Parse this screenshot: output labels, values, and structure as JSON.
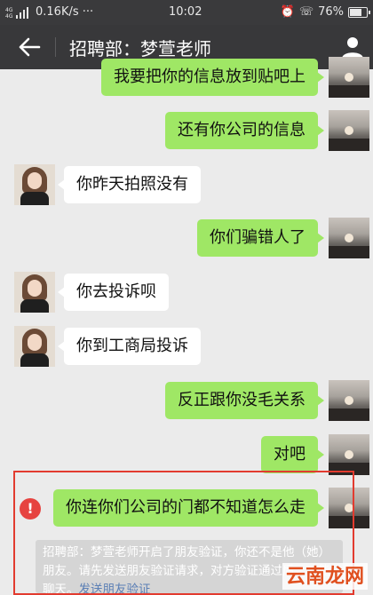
{
  "status": {
    "speed": "0.16K/s ···",
    "time": "10:02",
    "battery": "76%"
  },
  "header": {
    "title": "招聘部：梦萱老师"
  },
  "messages": [
    {
      "side": "me",
      "text": "我要把你的信息放到贴吧上"
    },
    {
      "side": "me",
      "text": "还有你公司的信息"
    },
    {
      "side": "them",
      "text": "你昨天拍照没有"
    },
    {
      "side": "me",
      "text": "你们骗错人了"
    },
    {
      "side": "them",
      "text": "你去投诉呗"
    },
    {
      "side": "them",
      "text": "你到工商局投诉"
    },
    {
      "side": "me",
      "text": "反正跟你没毛关系"
    },
    {
      "side": "me",
      "text": "对吧"
    },
    {
      "side": "me",
      "text": "你连你们公司的门都不知道怎么走",
      "failed": true
    }
  ],
  "notice": {
    "text": "招聘部：梦萱老师开启了朋友验证，你还不是他（她）朋友。请先发送朋友验证请求，对方验证通过后，才能聊天。",
    "link": "发送朋友验证"
  },
  "watermark": "云南龙网",
  "colors": {
    "my_bubble": "#9fe765",
    "their_bubble": "#ffffff",
    "highlight_box": "#e23b2f",
    "fail_badge": "#e64340"
  }
}
